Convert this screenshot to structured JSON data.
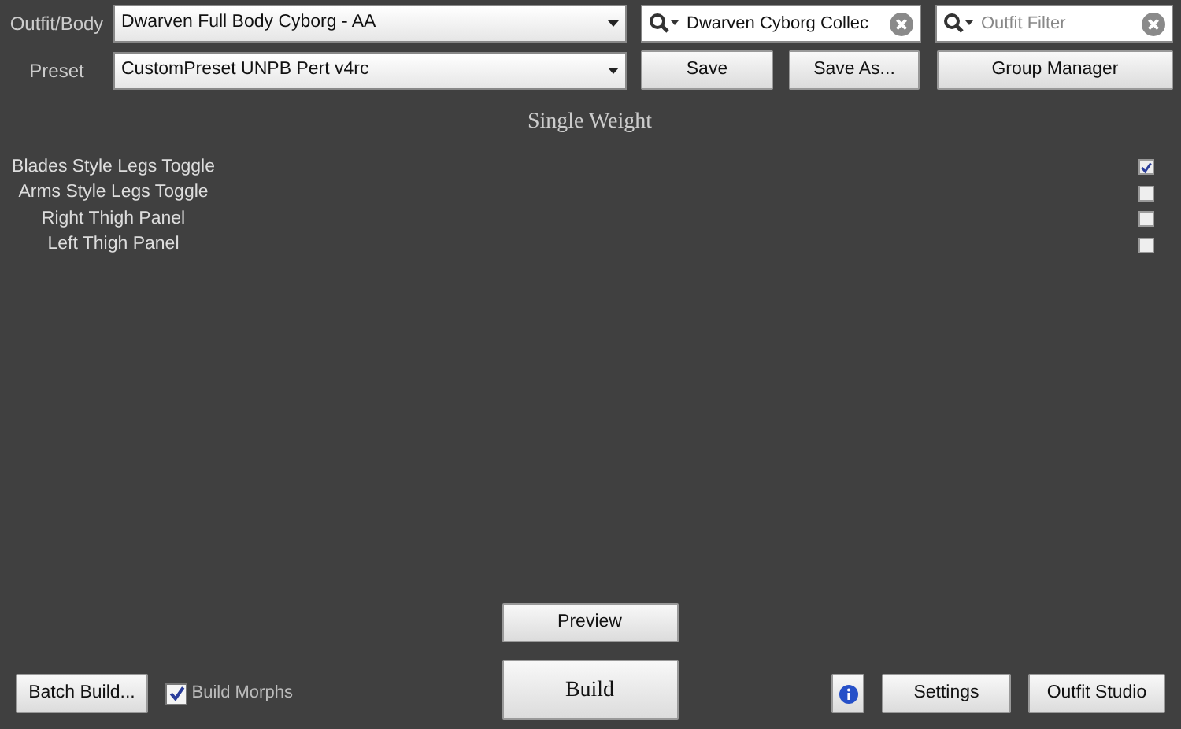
{
  "outfit_body": {
    "label": "Outfit/Body",
    "value": "Dwarven Full Body Cyborg - AA"
  },
  "preset": {
    "label": "Preset",
    "value": "CustomPreset UNPB Pert v4rc"
  },
  "group_search": {
    "value": "Dwarven Cyborg Collec"
  },
  "outfit_filter": {
    "placeholder": "Outfit Filter"
  },
  "preset_buttons": [
    "Save",
    "Save As...",
    "Group Manager"
  ],
  "section_title": "Single Weight",
  "sliders": [
    {
      "name": "Blades Style Legs Toggle",
      "checked": true
    },
    {
      "name": "Arms Style Legs Toggle",
      "checked": false
    },
    {
      "name": "Right Thigh Panel",
      "checked": false
    },
    {
      "name": "Left Thigh Panel",
      "checked": false
    }
  ],
  "preview_button": "Preview",
  "build_button": "Build",
  "batch_build_button": "Batch Build...",
  "build_morphs": {
    "label": "Build Morphs",
    "checked": true
  },
  "settings_button": "Settings",
  "outfit_studio_button": "Outfit Studio"
}
